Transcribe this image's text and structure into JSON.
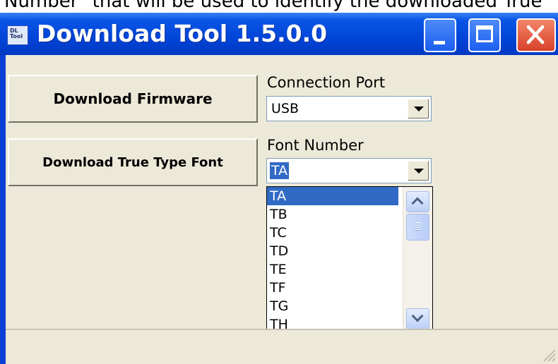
{
  "snippet_text": "Number\" that will be used to identify the downloaded True",
  "window": {
    "title": "Download Tool 1.5.0.0",
    "icon_text_1": "DL",
    "icon_text_2": "Tool",
    "controls": [
      "minimize",
      "maximize",
      "close"
    ]
  },
  "buttons": {
    "download_firmware": "Download Firmware",
    "download_ttf": "Download True Type Font"
  },
  "connection_port": {
    "label": "Connection Port",
    "value": "USB"
  },
  "font_number": {
    "label": "Font Number",
    "value": "TA",
    "options": [
      "TA",
      "TB",
      "TC",
      "TD",
      "TE",
      "TF",
      "TG",
      "TH"
    ],
    "selected": "TA"
  },
  "colors": {
    "titlebar": "#0045d8",
    "client": "#ece9d8",
    "selection": "#316ac5",
    "close_button": "#d9412a"
  },
  "icons": [
    "app-icon",
    "minimize-icon",
    "maximize-icon",
    "close-icon",
    "chevron-down-icon",
    "scroll-up-icon",
    "scroll-down-icon",
    "resize-grip-icon"
  ]
}
